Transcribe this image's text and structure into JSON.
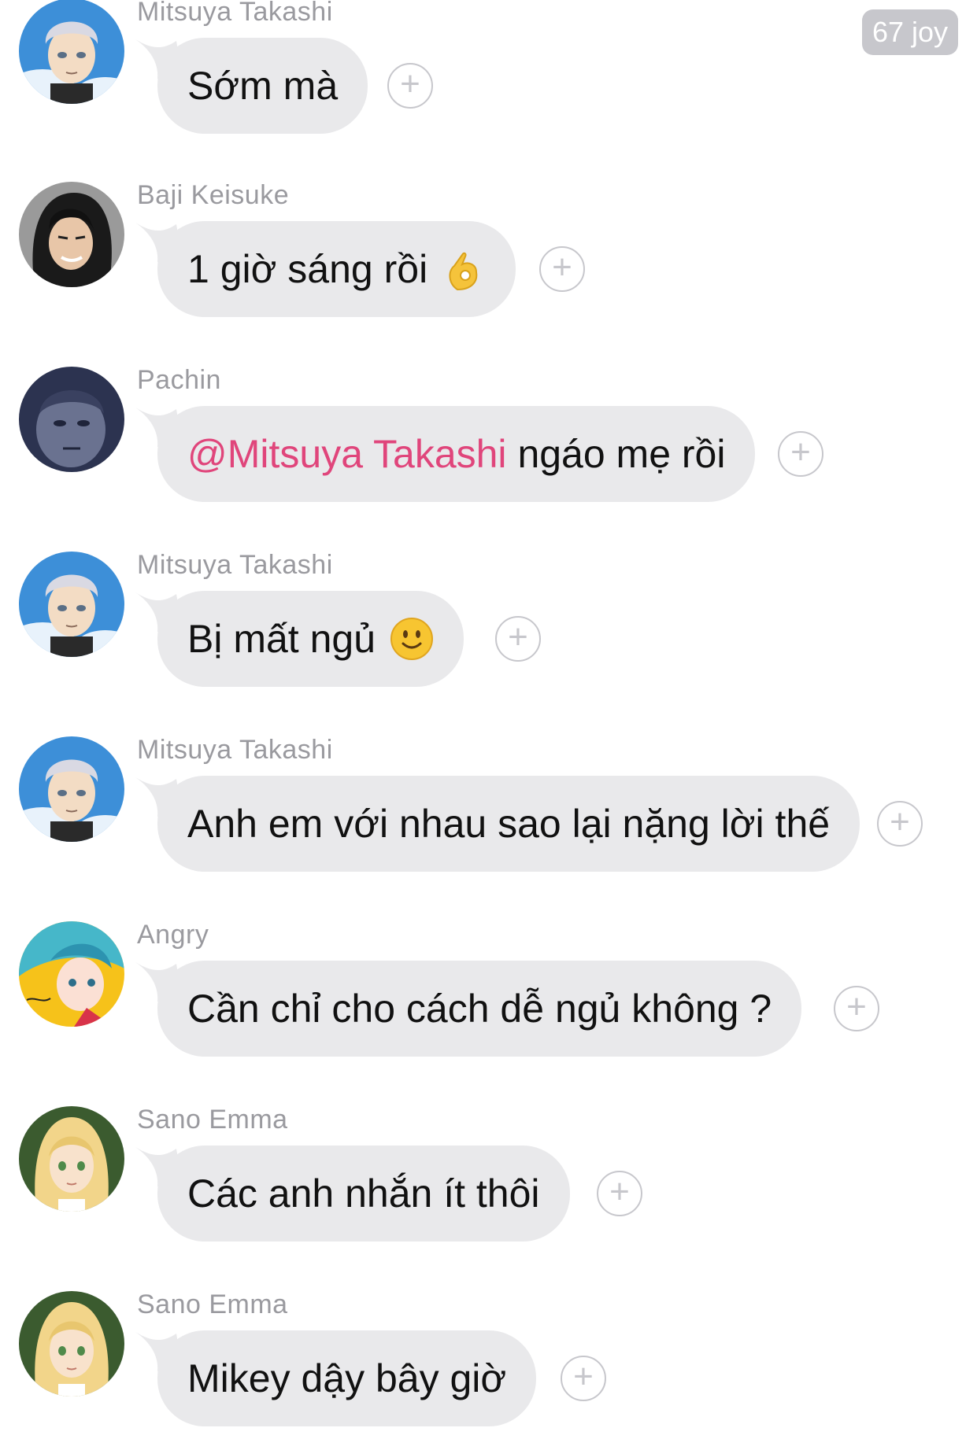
{
  "badge": {
    "label": "67 joy"
  },
  "messages": [
    {
      "sender": "Mitsuya Takashi",
      "text": "Sớm mà",
      "avatar": "mitsuya"
    },
    {
      "sender": "Baji Keisuke",
      "text": "1 giờ sáng rồi",
      "emoji": "ok-hand",
      "avatar": "baji"
    },
    {
      "sender": "Pachin",
      "mention": "@Mitsuya Takashi",
      "text": " ngáo mẹ rồi",
      "avatar": "pachin"
    },
    {
      "sender": "Mitsuya Takashi",
      "text": "Bị mất ngủ",
      "emoji": "slight-smile",
      "avatar": "mitsuya"
    },
    {
      "sender": "Mitsuya Takashi",
      "text": "Anh em với nhau sao lại nặng lời thế",
      "avatar": "mitsuya"
    },
    {
      "sender": "Angry",
      "text": "Cần chỉ cho cách dễ ngủ không ?",
      "avatar": "angry"
    },
    {
      "sender": "Sano Emma",
      "text": "Các anh nhắn ít thôi",
      "avatar": "emma"
    },
    {
      "sender": "Sano Emma",
      "text": "Mikey dậy bây giờ",
      "avatar": "emma"
    }
  ],
  "react_icon": "+",
  "colors": {
    "bubble": "#e9e9eb",
    "sender": "#9a9a9f",
    "mention": "#e0457b",
    "reaction": "#c7c7cc"
  }
}
